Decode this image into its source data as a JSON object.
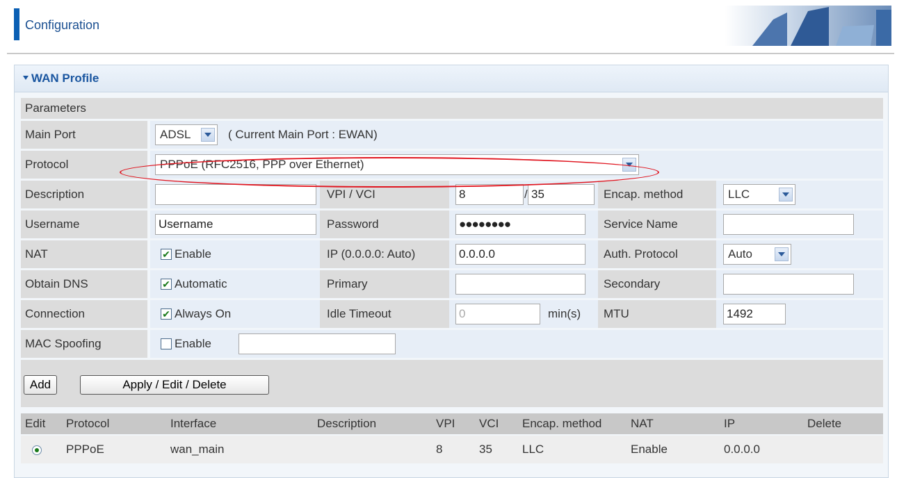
{
  "header": {
    "title": "Configuration"
  },
  "wan": {
    "section_title": "WAN Profile",
    "params_heading": "Parameters",
    "main_port": {
      "label": "Main Port",
      "value": "ADSL",
      "current": "( Current Main Port : EWAN)"
    },
    "protocol": {
      "label": "Protocol",
      "value": "PPPoE (RFC2516, PPP over Ethernet)"
    },
    "description": {
      "label": "Description",
      "value": ""
    },
    "vpi_vci": {
      "label": "VPI / VCI",
      "vpi": "8",
      "separator": "/",
      "vci": "35"
    },
    "encap": {
      "label": "Encap. method",
      "value": "LLC"
    },
    "username": {
      "label": "Username",
      "value": "Username"
    },
    "password": {
      "label": "Password",
      "value": "●●●●●●●●"
    },
    "service_name": {
      "label": "Service Name",
      "value": ""
    },
    "nat": {
      "label": "NAT",
      "option": "Enable",
      "checked": true
    },
    "ip": {
      "label": "IP (0.0.0.0: Auto)",
      "value": "0.0.0.0"
    },
    "auth": {
      "label": "Auth. Protocol",
      "value": "Auto"
    },
    "dns": {
      "label": "Obtain DNS",
      "option": "Automatic",
      "checked": true,
      "primary_label": "Primary",
      "primary_value": "",
      "secondary_label": "Secondary",
      "secondary_value": ""
    },
    "connection": {
      "label": "Connection",
      "option": "Always On",
      "checked": true,
      "idle_label": "Idle Timeout",
      "idle_value": "0",
      "idle_unit": "min(s)",
      "mtu_label": "MTU",
      "mtu_value": "1492"
    },
    "mac": {
      "label": "MAC Spoofing",
      "option": "Enable",
      "checked": false,
      "value": ""
    },
    "buttons": {
      "add": "Add",
      "apply": "Apply / Edit / Delete"
    },
    "table": {
      "headers": [
        "Edit",
        "Protocol",
        "Interface",
        "Description",
        "VPI",
        "VCI",
        "Encap. method",
        "NAT",
        "IP",
        "Delete"
      ],
      "rows": [
        {
          "protocol": "PPPoE",
          "interface": "wan_main",
          "description": "",
          "vpi": "8",
          "vci": "35",
          "encap": "LLC",
          "nat": "Enable",
          "ip": "0.0.0.0",
          "delete": ""
        }
      ]
    }
  },
  "colors": {
    "highlight": "#e0141e",
    "brand": "#0a5fb4"
  }
}
